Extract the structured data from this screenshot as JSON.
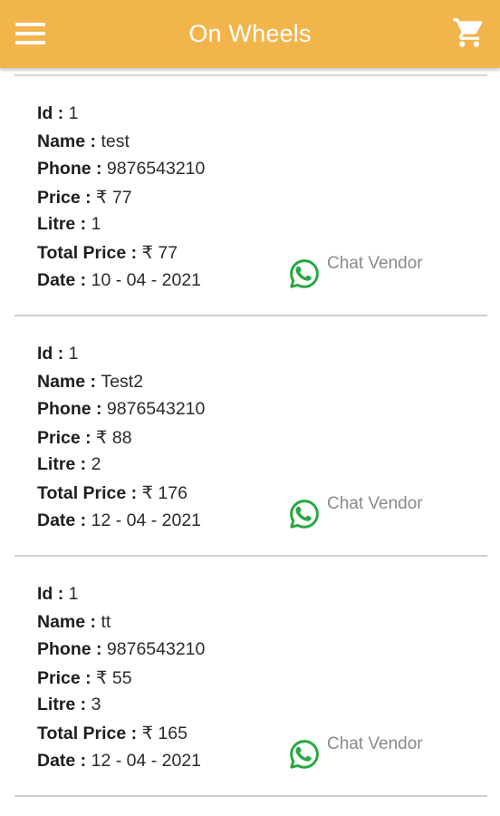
{
  "app": {
    "title": "On Wheels"
  },
  "labels": {
    "id": "Id : ",
    "name": "Name : ",
    "phone": "Phone : ",
    "price": "Price : ",
    "litre": "Litre : ",
    "total": "Total Price : ",
    "date": "Date : ",
    "chat": "Chat Vendor"
  },
  "colors": {
    "appbar": "#F2B54C",
    "whatsapp": "#25A83F",
    "chat_text": "#8A8A8A"
  },
  "icons": {
    "menu": "hamburger-menu",
    "cart": "shopping-cart",
    "chat": "whatsapp"
  },
  "orders": [
    {
      "id": "1",
      "name": "test",
      "phone": "9876543210",
      "price": "₹ 77",
      "litre": "1",
      "total": "₹ 77",
      "date": "10 - 04 - 2021"
    },
    {
      "id": "1",
      "name": "Test2",
      "phone": "9876543210",
      "price": "₹ 88",
      "litre": "2",
      "total": "₹ 176",
      "date": "12 - 04 - 2021"
    },
    {
      "id": "1",
      "name": "tt",
      "phone": "9876543210",
      "price": "₹ 55",
      "litre": "3",
      "total": "₹ 165",
      "date": "12 - 04 - 2021"
    }
  ]
}
